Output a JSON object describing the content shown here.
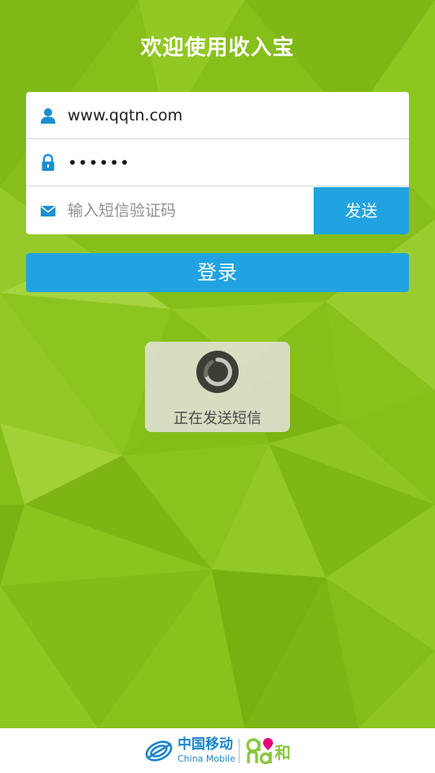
{
  "app": {
    "title": "欢迎使用收入宝"
  },
  "login_form": {
    "username": {
      "value": "www.qqtn.com",
      "icon": "user-icon"
    },
    "password": {
      "value": "••••••",
      "icon": "lock-icon"
    },
    "sms_code": {
      "placeholder": "输入短信验证码",
      "icon": "mail-icon"
    },
    "send_label": "发送",
    "login_label": "登录"
  },
  "toast": {
    "message": "正在发送短信"
  },
  "footer": {
    "carrier_name": "中国移动",
    "carrier_name_en": "China Mobile",
    "brand_suffix": "和"
  },
  "colors": {
    "background_green": "#8bc21c",
    "accent_blue": "#20a3e0",
    "carrier_blue": "#1b86c8",
    "brand_green": "#8cc63f",
    "brand_pink": "#e6007e"
  }
}
